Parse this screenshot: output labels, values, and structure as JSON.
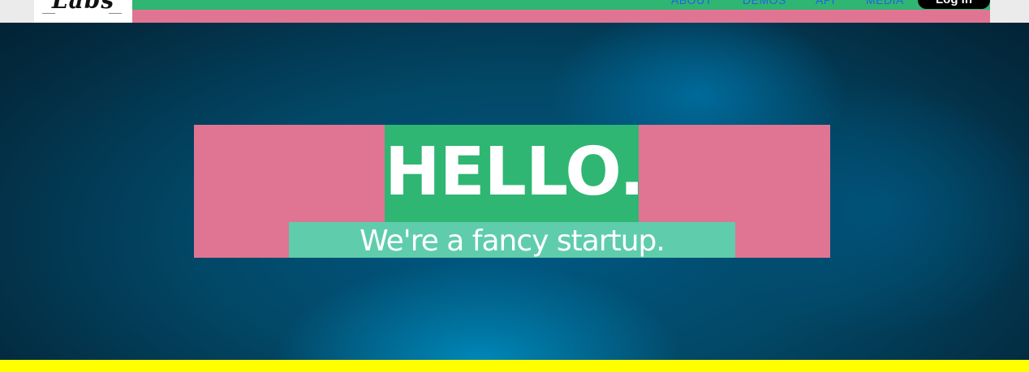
{
  "header": {
    "logo_text": "Labs",
    "nav": [
      "ABOUT",
      "DEMOS",
      "API",
      "MEDIA"
    ],
    "login_label": "Log in"
  },
  "hero": {
    "title": "HELLO.",
    "subtitle": "We're a fancy startup."
  },
  "colors": {
    "green": "#2fb673",
    "pink": "#e07593",
    "mint": "#5fcdab",
    "yellow": "#ffff00",
    "link_blue": "#2460e6",
    "hero_dark": "#032b40"
  }
}
